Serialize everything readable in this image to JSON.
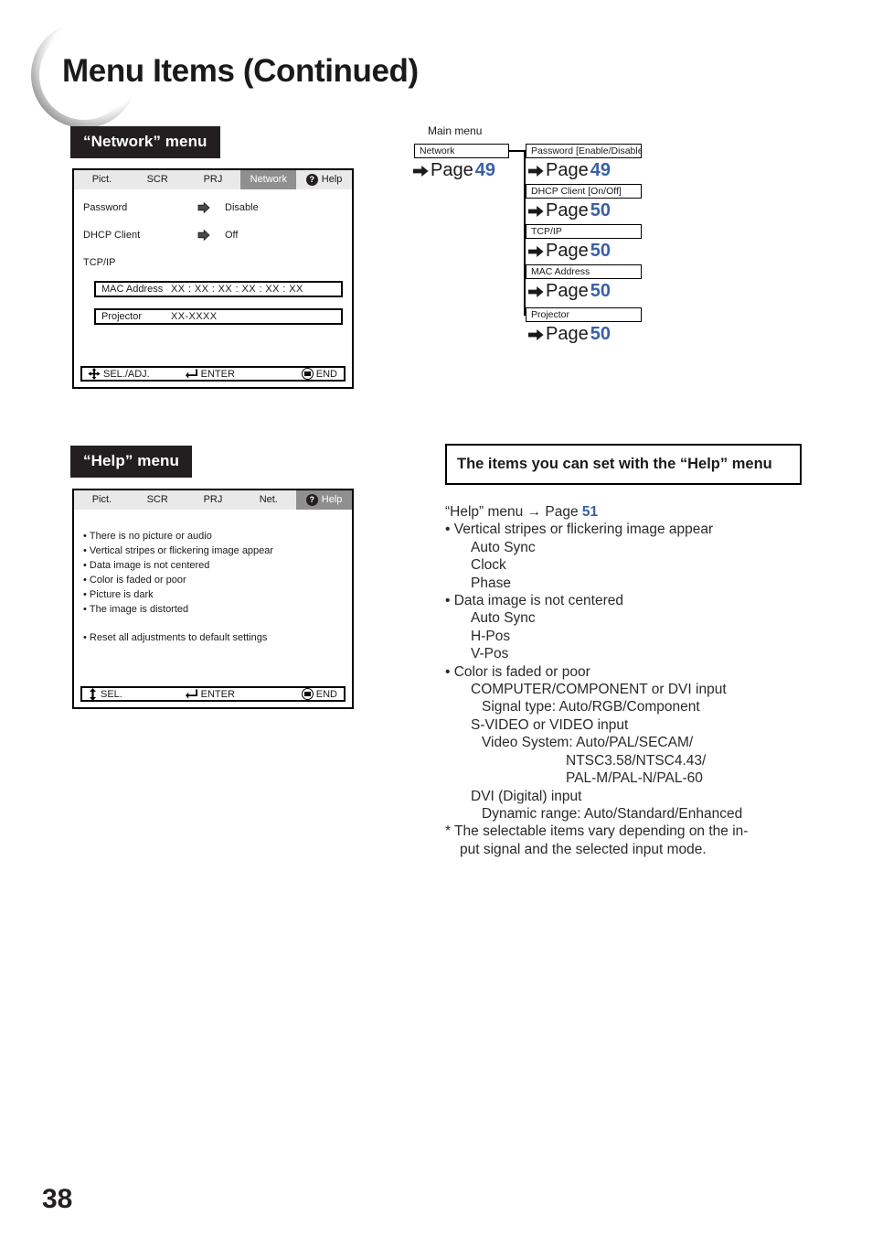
{
  "document": {
    "title": "Menu Items (Continued)",
    "page_number": "38",
    "accent_blue": "#3a5fa8",
    "tag_background": "#231f20"
  },
  "sections": {
    "network_tag": "“Network” menu",
    "help_tag": "“Help” menu"
  },
  "network_osd": {
    "tabs": [
      {
        "label": "Pict.",
        "selected": false
      },
      {
        "label": "SCR",
        "selected": false
      },
      {
        "label": "PRJ",
        "selected": false
      },
      {
        "label": "Network",
        "selected": true
      },
      {
        "label": "Help",
        "selected": false,
        "icon": "question-mark-icon",
        "icon_glyph": "?"
      }
    ],
    "rows": [
      {
        "label": "Password",
        "value": "Disable",
        "arrow": "right-arrow-icon"
      },
      {
        "label": "DHCP Client",
        "value": "Off",
        "arrow": "right-arrow-icon"
      },
      {
        "label": "TCP/IP",
        "value": "",
        "arrow": ""
      }
    ],
    "fields": [
      {
        "label": "MAC Address",
        "value": "XX : XX : XX : XX : XX : XX"
      },
      {
        "label": "Projector",
        "value": "XX-XXXX"
      }
    ],
    "footer": [
      {
        "icon": "four-way-arrow-icon",
        "label": "SEL./ADJ."
      },
      {
        "icon": "enter-arrow-icon",
        "label": "ENTER"
      },
      {
        "icon": "end-button-icon",
        "label": "END"
      }
    ]
  },
  "help_osd": {
    "tabs": [
      {
        "label": "Pict.",
        "selected": false
      },
      {
        "label": "SCR",
        "selected": false
      },
      {
        "label": "PRJ",
        "selected": false
      },
      {
        "label": "Net.",
        "selected": false
      },
      {
        "label": "Help",
        "selected": true,
        "icon": "question-mark-icon",
        "icon_glyph": "?"
      }
    ],
    "items": [
      "There is no picture or audio",
      "Vertical stripes or flickering image appear",
      "Data image is not centered",
      "Color is faded or poor",
      "Picture is dark",
      "The image is distorted"
    ],
    "reset_item": "Reset all adjustments to default settings",
    "footer": [
      {
        "icon": "up-down-arrow-icon",
        "label": "SEL."
      },
      {
        "icon": "enter-arrow-icon",
        "label": "ENTER"
      },
      {
        "icon": "end-button-icon",
        "label": "END"
      }
    ]
  },
  "flow": {
    "main_menu_label": "Main menu",
    "root": {
      "box": "Network",
      "page_word": "Page",
      "page": "49"
    },
    "children": [
      {
        "box": "Password [Enable/Disable]",
        "page_word": "Page",
        "page": "49"
      },
      {
        "box": "DHCP Client [On/Off]",
        "page_word": "Page",
        "page": "50"
      },
      {
        "box": "TCP/IP",
        "page_word": "Page",
        "page": "50"
      },
      {
        "box": "MAC Address",
        "page_word": "Page",
        "page": "50"
      },
      {
        "box": "Projector",
        "page_word": "Page",
        "page": "50"
      }
    ]
  },
  "help_panel": {
    "title": "The items you can set with the “Help” menu",
    "head_prefix": "“Help” menu",
    "head_arrow": "→",
    "head_page_word": "Page",
    "head_page": "51",
    "lines": [
      {
        "indent": "l0",
        "text": "• Vertical stripes or flickering image appear"
      },
      {
        "indent": "l1",
        "text": "Auto Sync"
      },
      {
        "indent": "l1",
        "text": "Clock"
      },
      {
        "indent": "l1",
        "text": "Phase"
      },
      {
        "indent": "l0",
        "text": "• Data image is not centered"
      },
      {
        "indent": "l1",
        "text": "Auto Sync"
      },
      {
        "indent": "l1",
        "text": "H-Pos"
      },
      {
        "indent": "l1",
        "text": "V-Pos"
      },
      {
        "indent": "l0",
        "text": "• Color is faded or poor"
      },
      {
        "indent": "l1",
        "text": "COMPUTER/COMPONENT or DVI input"
      },
      {
        "indent": "l2",
        "text": "Signal type: Auto/RGB/Component"
      },
      {
        "indent": "l1",
        "text": "S-VIDEO or VIDEO input"
      },
      {
        "indent": "l2",
        "text": "Video System: Auto/PAL/SECAM/"
      },
      {
        "indent": "l3",
        "text": "NTSC3.58/NTSC4.43/"
      },
      {
        "indent": "l3",
        "text": "PAL-M/PAL-N/PAL-60"
      },
      {
        "indent": "l1",
        "text": "DVI (Digital) input"
      },
      {
        "indent": "l2",
        "text": "Dynamic range: Auto/Standard/Enhanced"
      },
      {
        "indent": "lnote",
        "text": "* The selectable items vary depending on the in-"
      },
      {
        "indent": "lnote2",
        "text": "put signal and the selected input mode."
      }
    ]
  }
}
